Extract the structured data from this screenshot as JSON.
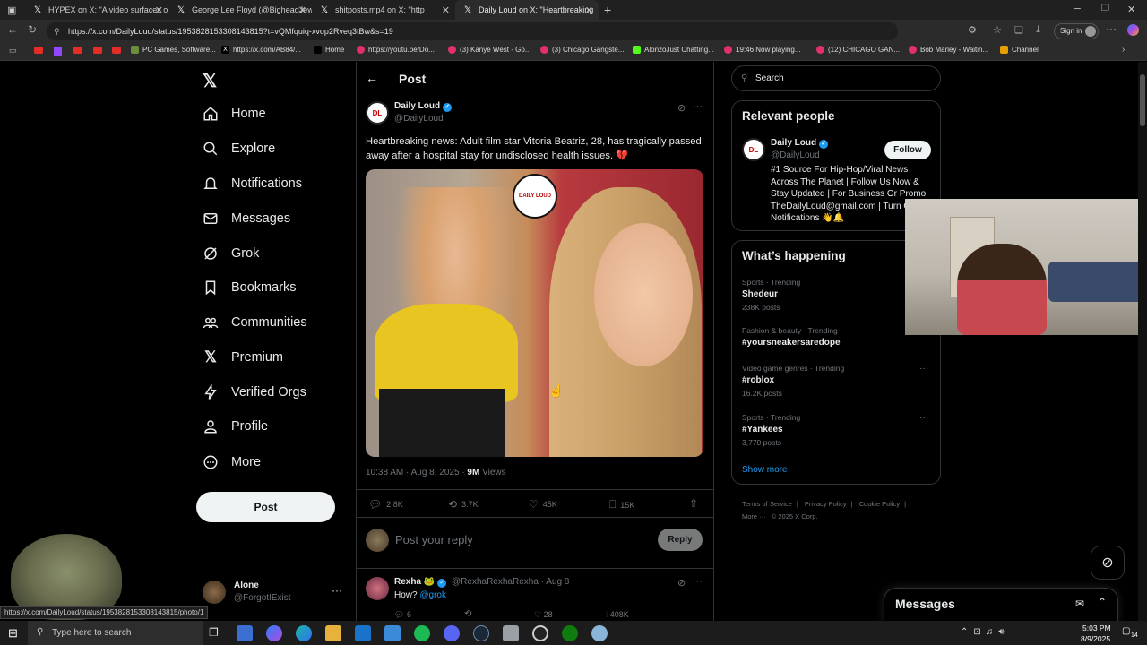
{
  "browser": {
    "tabs": [
      {
        "title": "HYPEX on X: \"A video surfaces of"
      },
      {
        "title": "George Lee Floyd (@BigheadJew)"
      },
      {
        "title": "shitposts.mp4  on X: \"http"
      },
      {
        "title": "Daily Loud on X: \"Heartbreaking"
      }
    ],
    "url": "https://x.com/DailyLoud/status/1953828153308143815?t=vQMfquiq-xvop2Rveq3tBw&s=19",
    "signin_label": "Sign in",
    "bookmarks": [
      "PC Games, Software...",
      "https://x.com/AB84/...",
      "Home",
      "https://youtu.be/Do...",
      "(3) Kanye West - Go...",
      "(3) Chicago Gangste...",
      "AlonzoJust Chatting...",
      "19:46 Now playing...",
      "(12) CHICAGO GAN...",
      "Bob Marley - Waitin...",
      "Channel"
    ]
  },
  "nav": {
    "items": [
      "Home",
      "Explore",
      "Notifications",
      "Messages",
      "Grok",
      "Bookmarks",
      "Communities",
      "Premium",
      "Verified Orgs",
      "Profile",
      "More"
    ],
    "post_button": "Post",
    "account_name": "Alone",
    "account_handle": "@ForgotIExist"
  },
  "post": {
    "header_title": "Post",
    "author_name": "Daily Loud",
    "author_handle": "@DailyLoud",
    "text": "Heartbreaking news: Adult film star Vitoria Beatriz, 28, has tragically passed away after a hospital stay for undisclosed health issues. 💔",
    "image_badge": "DAILY LOUD",
    "timestamp": "10:38 AM · Aug 8, 2025 · ",
    "views_count": "9M",
    "views_label": " Views",
    "replies": "2.8K",
    "reposts": "3.7K",
    "likes": "45K",
    "bookmarks": "15K",
    "reply_placeholder": "Post your reply",
    "reply_button": "Reply"
  },
  "reply": {
    "name": "Rexha 🐸",
    "handle": "@RexhaRexhaRexha · Aug 8",
    "text_prefix": "How? ",
    "mention": "@grok",
    "replies": "6",
    "likes": "28",
    "views": "408K"
  },
  "sidebar": {
    "search_placeholder": "Search",
    "relevant_title": "Relevant people",
    "rp_name": "Daily Loud",
    "rp_handle": "@DailyLoud",
    "rp_follow": "Follow",
    "rp_bio": "#1 Source For Hip-Hop/Viral News Across The Planet | Follow Us Now & Stay Updated | For Business Or Promo TheDailyLoud@gmail.com | Turn On Notifications 👋🔔",
    "happening_title": "What’s happening",
    "trends": [
      {
        "category": "Sports · Trending",
        "name": "Shedeur",
        "count": "238K posts"
      },
      {
        "category": "Fashion & beauty · Trending",
        "name": "#yoursneakersaredope",
        "count": ""
      },
      {
        "category": "Video game genres · Trending",
        "name": "#roblox",
        "count": "16.2K posts"
      },
      {
        "category": "Sports · Trending",
        "name": "#Yankees",
        "count": "3,770 posts"
      }
    ],
    "show_more": "Show more",
    "footer_links": [
      "Terms of Service",
      "Privacy Policy",
      "Cookie Policy",
      "More ···",
      "© 2025 X Corp."
    ],
    "messages_title": "Messages"
  },
  "status_link": "https://x.com/DailyLoud/status/1953828153308143815/photo/1",
  "taskbar": {
    "search_placeholder": "Type here to search",
    "time": "5:03 PM",
    "date": "8/9/2025",
    "notif_count": "14"
  },
  "colors": {
    "accent": "#1d9bf0",
    "bg": "#000000",
    "border": "#2f3336"
  }
}
